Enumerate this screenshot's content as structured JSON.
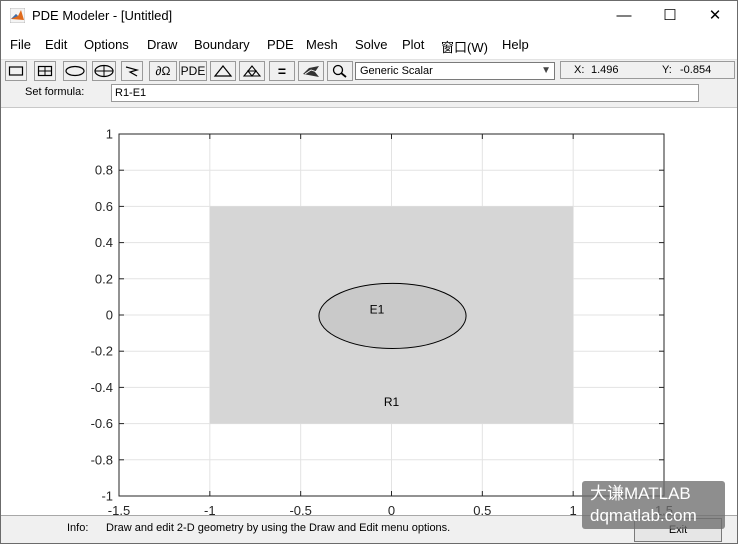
{
  "window": {
    "title": "PDE Modeler - [Untitled]",
    "minimize_glyph": "—",
    "maximize_glyph": "☐",
    "close_glyph": "✕"
  },
  "menu": {
    "file": "File",
    "edit": "Edit",
    "options": "Options",
    "draw": "Draw",
    "boundary": "Boundary",
    "pde": "PDE",
    "mesh": "Mesh",
    "solve": "Solve",
    "plot": "Plot",
    "window": "窗口(W)",
    "help": "Help"
  },
  "toolbar": {
    "pde_label": "PDE",
    "partial_omega_label": "∂Ω",
    "equals_label": "=",
    "application_select": "Generic Scalar",
    "x_label": "X:",
    "x_value": "1.496",
    "y_label": "Y:",
    "y_value": "-0.854"
  },
  "formula": {
    "label": "Set formula:",
    "value": "R1-E1"
  },
  "plot": {
    "rect_label": "R1",
    "ellipse_label": "E1",
    "rect_fill": "#d6d6d6",
    "ellipse_fill": "#c9c9c9",
    "x_ticks": [
      "-1.5",
      "-1",
      "-0.5",
      "0",
      "0.5",
      "1",
      "1.5"
    ],
    "y_ticks": [
      "1",
      "0.8",
      "0.6",
      "0.4",
      "0.2",
      "0",
      "-0.2",
      "-0.4",
      "-0.6",
      "-0.8",
      "-1"
    ]
  },
  "status": {
    "info_label": "Info:",
    "info_text": "Draw and edit 2-D geometry by using the Draw and Edit menu options.",
    "exit_label": "Exit"
  },
  "watermark": {
    "line1": "大谦MATLAB",
    "line2": "dqmatlab.com"
  }
}
